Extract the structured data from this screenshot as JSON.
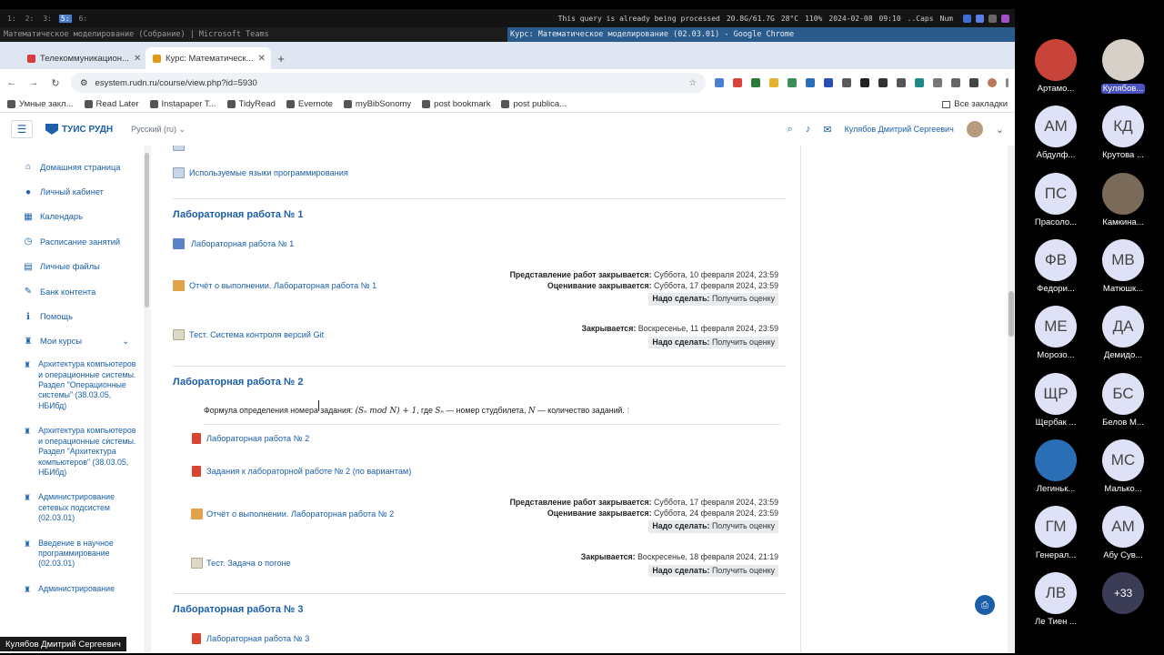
{
  "system_bar": {
    "workspaces": [
      "1:",
      "2:",
      "3:",
      "5:",
      "6:"
    ],
    "active_workspace_index": 3,
    "status": "This query is already being processed",
    "memory": "20.8G/61.7G",
    "temp": "28°C",
    "volume": "110%",
    "date": "2024-02-08",
    "time": "09:10",
    "caps": "..Caps",
    "num": "Num"
  },
  "window_titles": {
    "left": "Математическое моделирование (Собрание) | Microsoft Teams",
    "right": "Курс: Математическое моделирование (02.03.01) - Google Chrome"
  },
  "browser": {
    "tabs": [
      {
        "label": "Телекоммуникацион...",
        "active": false,
        "fav_color": "#d93a3a"
      },
      {
        "label": "Курс: Математическ...",
        "active": true,
        "fav_color": "#e29a1a"
      }
    ],
    "url": "esystem.rudn.ru/course/view.php?id=5930",
    "bookmarks": [
      "Умные закл...",
      "Read Later",
      "Instapaper T...",
      "TidyRead",
      "Evernote",
      "myBibSonomy",
      "post bookmark",
      "post publica..."
    ],
    "all_bookmarks": "Все закладки"
  },
  "site": {
    "logo": "ТУИС РУДН",
    "language": "Русский (ru)",
    "user_name": "Кулябов Дмитрий Сергеевич"
  },
  "sidebar": {
    "items": [
      {
        "label": "Домашняя страница",
        "icon": "home-icon",
        "glyph": "⌂"
      },
      {
        "label": "Личный кабинет",
        "icon": "user-circle-icon",
        "glyph": "●"
      },
      {
        "label": "Календарь",
        "icon": "calendar-icon",
        "glyph": "▦"
      },
      {
        "label": "Расписание занятий",
        "icon": "clock-icon",
        "glyph": "◷"
      },
      {
        "label": "Личные файлы",
        "icon": "file-icon",
        "glyph": "▤"
      },
      {
        "label": "Банк контента",
        "icon": "brush-icon",
        "glyph": "✎"
      },
      {
        "label": "Помощь",
        "icon": "info-icon",
        "glyph": "ℹ"
      },
      {
        "label": "Мои курсы",
        "icon": "graduation-cap-icon",
        "glyph": "♜"
      }
    ],
    "courses": [
      "Архитектура компьютеров и операционные системы. Раздел \"Операционные системы\" (38.03.05, НБИбд)",
      "Архитектура компьютеров и операционные системы. Раздел \"Архитектура компьютеров\" (38.03.05, НБИбд)",
      "Администрирование сетевых подсистем (02.03.01)",
      "Введение в научное программирование (02.03.01)",
      "Администрирование"
    ]
  },
  "main": {
    "top_item": "Используемые языки программирования",
    "labels": {
      "submit_closes": "Представление работ закрывается:",
      "grading_closes": "Оценивание закрывается:",
      "closes": "Закрывается:",
      "todo": "Надо сделать:",
      "todo_value": "Получить оценку"
    },
    "lab1": {
      "title": "Лабораторная работа № 1",
      "folder": "Лабораторная работа № 1",
      "report": "Отчёт о выполнении. Лабораторная работа № 1",
      "report_submit": "Суббота, 10 февраля 2024, 23:59",
      "report_grade": "Суббота, 17 февраля 2024, 23:59",
      "quiz": "Тест. Система контроля версий Git",
      "quiz_closes": "Воскресенье, 11 февраля 2024, 23:59"
    },
    "lab2": {
      "title": "Лабораторная работа № 2",
      "formula_prefix": "Формула определения номера задания:",
      "formula_expr": "(Sₙ mod N) + 1",
      "formula_mid": ", где",
      "formula_sn": "Sₙ",
      "formula_mid2": "— номер студбилета,",
      "formula_n": "N",
      "formula_suffix": "— количество заданий.",
      "pdf1": "Лабораторная работа № 2",
      "pdf2": "Задания к лабораторной работе № 2 (по вариантам)",
      "report": "Отчёт о выполнении. Лабораторная работа № 2",
      "report_submit": "Суббота, 17 февраля 2024, 23:59",
      "report_grade": "Суббота, 24 февраля 2024, 23:59",
      "quiz": "Тест. Задача о погоне",
      "quiz_closes": "Воскресенье, 18 февраля 2024, 21:19"
    },
    "lab3": {
      "title": "Лабораторная работа № 3",
      "pdf1": "Лабораторная работа № 3"
    }
  },
  "presenter": "Кулябов Дмитрий Сергеевич",
  "participants": [
    {
      "initials": "",
      "name": "Артамо...",
      "photo": true,
      "avatar_color": "#c8443a"
    },
    {
      "initials": "",
      "name": "Кулябов...",
      "photo": true,
      "highlight": true,
      "avatar_color": "#d6d0c8"
    },
    {
      "initials": "АМ",
      "name": "Абдулф..."
    },
    {
      "initials": "КД",
      "name": "Крутова ..."
    },
    {
      "initials": "ПС",
      "name": "Прасоло..."
    },
    {
      "initials": "",
      "name": "Камкина...",
      "photo": true,
      "avatar_color": "#7a6a5a"
    },
    {
      "initials": "ФВ",
      "name": "Федори..."
    },
    {
      "initials": "МВ",
      "name": "Матюшк..."
    },
    {
      "initials": "МЕ",
      "name": "Морозо..."
    },
    {
      "initials": "ДА",
      "name": "Демидо..."
    },
    {
      "initials": "ЩР",
      "name": "Щербак ..."
    },
    {
      "initials": "БС",
      "name": "Белов М..."
    },
    {
      "initials": "",
      "name": "Легиньк...",
      "photo": true,
      "avatar_color": "#2a6fb6"
    },
    {
      "initials": "МС",
      "name": "Малько..."
    },
    {
      "initials": "ГМ",
      "name": "Генерал..."
    },
    {
      "initials": "АМ",
      "name": "Абу Сув..."
    },
    {
      "initials": "ЛВ",
      "name": "Ле Тиен ..."
    },
    {
      "initials": "+33",
      "name": "",
      "more": true
    }
  ],
  "colors": {
    "link": "#1a5fa8",
    "todo_bg": "#e9ecef",
    "avatar_bg": "#dfe2f6",
    "teams_highlight": "#4a52c4"
  }
}
